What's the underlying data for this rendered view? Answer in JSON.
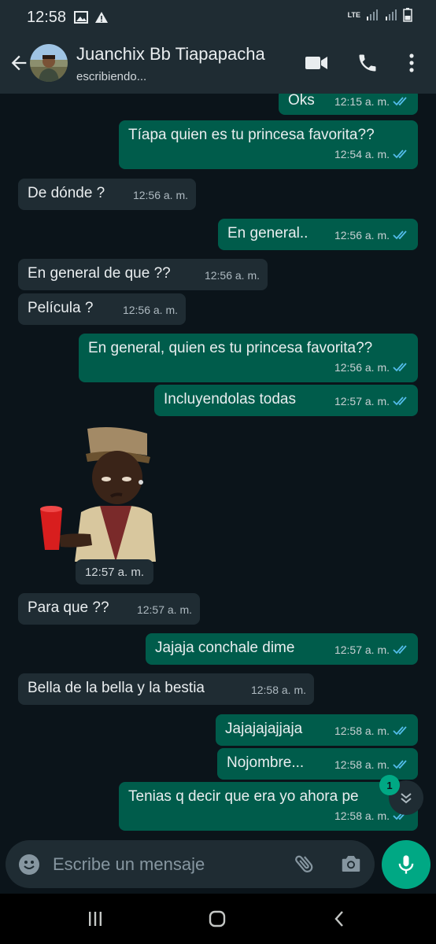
{
  "status_bar": {
    "time": "12:58",
    "network_label": "LTE"
  },
  "header": {
    "contact_name": "Juanchix Bb Tiapapacha",
    "status": "escribiendo..."
  },
  "messages": [
    {
      "dir": "out",
      "text": "Oks",
      "time": "12:15 a. m.",
      "read": true
    },
    {
      "dir": "out",
      "text": "Tíapa quien es tu princesa favorita??",
      "time": "12:54 a. m.",
      "read": true
    },
    {
      "dir": "in",
      "text": "De dónde ?",
      "time": "12:56 a. m."
    },
    {
      "dir": "out",
      "text": "En general..",
      "time": "12:56 a. m.",
      "read": true
    },
    {
      "dir": "in",
      "text": "En general de que ??",
      "time": "12:56 a. m."
    },
    {
      "dir": "in",
      "text": "Película ?",
      "time": "12:56 a. m."
    },
    {
      "dir": "out",
      "text": "En general, quien es tu princesa favorita??",
      "time": "12:56 a. m.",
      "read": true
    },
    {
      "dir": "out",
      "text": "Incluyendolas todas",
      "time": "12:57 a. m.",
      "read": true
    },
    {
      "dir": "in",
      "type": "sticker",
      "sticker": "man-with-red-cup-sticker",
      "time": "12:57 a. m."
    },
    {
      "dir": "in",
      "text": "Para que ??",
      "time": "12:57 a. m."
    },
    {
      "dir": "out",
      "text": "Jajaja conchale dime",
      "time": "12:57 a. m.",
      "read": true
    },
    {
      "dir": "in",
      "text": "Bella de la bella y la bestia",
      "time": "12:58 a. m."
    },
    {
      "dir": "out",
      "text": "Jajajajajjaja",
      "time": "12:58 a. m.",
      "read": true
    },
    {
      "dir": "out",
      "text": "Nojombre...",
      "time": "12:58 a. m.",
      "read": true
    },
    {
      "dir": "out",
      "text": "Tenias q decir que era yo ahora pe",
      "time": "12:58 a. m.",
      "read": true
    }
  ],
  "scroll_badge": "1",
  "composer": {
    "placeholder": "Escribe un mensaje"
  },
  "colors": {
    "chat_bg": "#0b141a",
    "incoming": "#1f2c33",
    "outgoing": "#005c4b",
    "accent": "#00a884",
    "read_tick": "#53bdeb"
  },
  "icons": [
    "back-arrow-icon",
    "video-call-icon",
    "phone-call-icon",
    "more-vert-icon",
    "emoji-icon",
    "attach-icon",
    "camera-icon",
    "mic-icon",
    "chevron-down-icon"
  ]
}
